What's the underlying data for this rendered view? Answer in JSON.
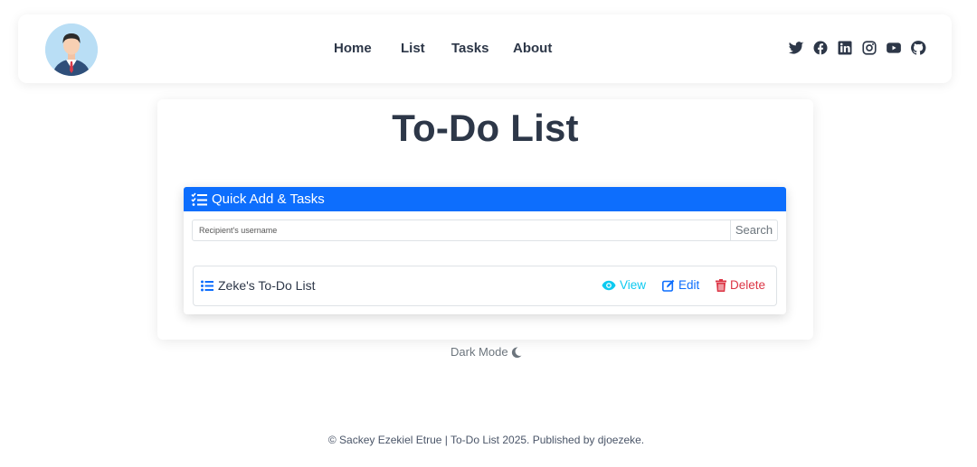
{
  "nav": {
    "links": [
      "Home",
      "List",
      "Tasks",
      "About"
    ],
    "social_icons": [
      "twitter-icon",
      "facebook-icon",
      "linkedin-icon",
      "instagram-icon",
      "youtube-icon",
      "github-icon"
    ]
  },
  "page": {
    "title": "To-Do List"
  },
  "quick_add": {
    "header": "Quick Add & Tasks",
    "search_placeholder": "Recipient's username",
    "search_button": "Search"
  },
  "list_item": {
    "name": "Zeke's To-Do List",
    "view_label": "View",
    "edit_label": "Edit",
    "delete_label": "Delete"
  },
  "dark_mode_label": "Dark Mode",
  "footer": "© Sackey Ezekiel Etrue | To-Do List 2025. Published by djoezeke.",
  "colors": {
    "primary": "#0d6efd",
    "info": "#0dcaf0",
    "danger": "#dc3545",
    "text": "#2d3748"
  }
}
